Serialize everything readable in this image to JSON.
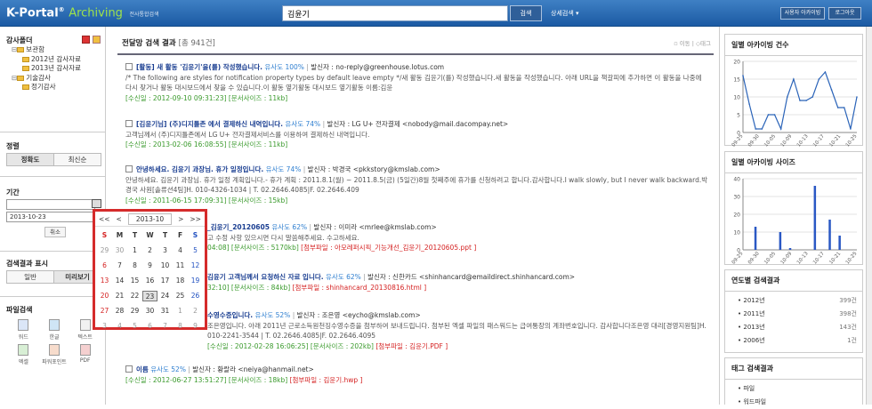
{
  "header": {
    "brand": "K-Portal",
    "brand_reg": "®",
    "app": "Archiving",
    "app_sub": "전사통합검색",
    "search_value": "김윤기",
    "search_button": "검색",
    "advanced": "상세검색",
    "my_button": "사용자 아카이빙",
    "logout_button": "로그아웃"
  },
  "left": {
    "folder_title": "감사폴더",
    "tree": [
      {
        "label": "보관함",
        "level": 0
      },
      {
        "label": "2012년 감사자료",
        "level": 1
      },
      {
        "label": "2013년 감사자료",
        "level": 1
      },
      {
        "label": "기술감사",
        "level": 0
      },
      {
        "label": "정기감사",
        "level": 1
      }
    ],
    "sort_title": "정렬",
    "sort_options": [
      "정확도",
      "최신순"
    ],
    "period_title": "기간",
    "date_from": "",
    "date_to": "2013-10-23",
    "cancel": "취소",
    "display_title": "검색결과 표시",
    "display_options": [
      "일반",
      "미리보기"
    ],
    "file_title": "파일검색",
    "file_types": [
      "워드",
      "한글",
      "텍스트",
      "엑셀",
      "파워포인트",
      "PDF"
    ]
  },
  "main": {
    "title": "전달망 검색 결과",
    "count": "[총 941건]",
    "tools": [
      "이동",
      "태그"
    ],
    "results": [
      {
        "title_pre": "[활동] 새 활동 '",
        "title_hl": "김윤기",
        "title_post": "'을(를) 작성했습니다.",
        "similarity": "유사도 100%",
        "sender": "발신자 : no-reply@greenhouse.lotus.com",
        "desc": "/* The following are styles for notification property types by default leave empty */새 활동 김윤기(를) 작성했습니다.새 활동을 작성했습니다. 아래 URL을 책갈피에 추가하면 이 활동을 나중에 다시 찾거나 활동 대시보드에서 찾을 수 있습니다.이 활동 옆기활동 대시보드 옆기활동 이름:김윤",
        "meta": "[수신일 : 2012-09-10 09:31:23] [문서사이즈 : 11kb]",
        "attach": ""
      },
      {
        "title_pre": "[김윤기님] (주)디지틀존 에서 결제하신 내역입니다.",
        "title_hl": "",
        "title_post": "",
        "similarity": "유사도 74%",
        "sender": "발신자 : LG U+ 전자결제 <nobody@mail.dacompay.net>",
        "desc": "고객님께서 (주)디지틀존에서 LG U+ 전자결제서비스를 이용하여 결제하신 내역입니다.",
        "meta": "[수신일 : 2013-02-06 16:08:55] [문서사이즈 : 11kb]",
        "attach": ""
      },
      {
        "title_pre": "안녕하세요. 김윤기 과장님. 휴가 일정입니다.",
        "title_hl": "",
        "title_post": "",
        "similarity": "유사도 74%",
        "sender": "발신자 : 박경국 <pkkstory@kmslab.com>",
        "desc": "안녕하세요. 김윤기 과장님. 휴가 일정 계획입니다.- 휴가 계획 : 2011.8.1(월) ~ 2011.8.5(금) (5일간)8월 첫째주에 휴가를 신청하려고 합니다.감사합니다.I walk slowly, but I never walk backward.박경국 사원[솔류션4팀]H. 010-4326-1034 | T. 02.2646.4085|F. 02.2646.409",
        "meta": "[수신일 : 2011-06-15 17:09:31] [문서사이즈 : 15kb]",
        "attach": ""
      },
      {
        "title_pre": "_김윤기_20120605",
        "title_hl": "",
        "title_post": "",
        "similarity": "유사도 62%",
        "sender": "발신자 : 이미라 <mrlee@kmslab.com>",
        "desc": "고 수정 사항 있으시면 다시 말씀해주세요. 수고하세요.",
        "meta": "04:08] [문서사이즈 : 5170kb]",
        "attach": "[첨부파일 : 아모레퍼시픽_기능개선_김윤기_20120605.ppt ]"
      },
      {
        "title_pre": "김윤기 고객님께서 요청하신 자료 입니다.",
        "title_hl": "",
        "title_post": "",
        "similarity": "유사도 62%",
        "sender": "발신자 : 신한카드 <shinhancard@emaildirect.shinhancard.com>",
        "desc": "",
        "meta": "32:10] [문서사이즈 : 84kb]",
        "attach": "[첨부파일 : shinhancard_20130816.html ]"
      },
      {
        "title_pre": "수영수증입니다.",
        "title_hl": "",
        "title_post": "",
        "similarity": "유사도 52%",
        "sender": "발신자 : 조은영 <eycho@kmslab.com>",
        "desc": "조은영입니다. 아래 2011년 근로소득원천징수영수증을 첨부하여 보내드립니다. 첨부된 엑셀 파일의 패스워드는 급여통장의 계좌번호입니다. 감사합니다조은영 대리[경영지원팀]H. 010-2241-3544 | T. 02.2646.4085|F. 02.2646.4095",
        "meta": "[수신일 : 2012-02-28 16:06:25] [문서사이즈 : 202kb]",
        "attach": "[첨부파일 : 김윤기.PDF ]"
      },
      {
        "title_pre": "이름",
        "title_hl": "",
        "title_post": "",
        "similarity": "유사도 52%",
        "sender": "발신자 : 황랄라 <neiya@hanmail.net>",
        "desc": "",
        "meta": "[수신일 : 2012-06-27 13:51:27] [문서사이즈 : 18kb]",
        "attach": "[첨부파일 : 김윤기.hwp ]"
      }
    ]
  },
  "calendar": {
    "prev_year": "<<",
    "prev_month": "<",
    "month": "2013-10",
    "next_month": ">",
    "next_year": ">>",
    "weekdays": [
      "S",
      "M",
      "T",
      "W",
      "T",
      "F",
      "S"
    ],
    "days": [
      "29",
      "30",
      "1",
      "2",
      "3",
      "4",
      "5",
      "6",
      "7",
      "8",
      "9",
      "10",
      "11",
      "12",
      "13",
      "14",
      "15",
      "16",
      "17",
      "18",
      "19",
      "20",
      "21",
      "22",
      "23",
      "24",
      "25",
      "26",
      "27",
      "28",
      "29",
      "30",
      "31",
      "1",
      "2",
      "3",
      "4",
      "5",
      "6",
      "7",
      "8",
      "9"
    ],
    "selected": "23"
  },
  "right": {
    "daily_count_title": "일별 아카이빙 건수",
    "daily_size_title": "일별 아카이빙 사이즈",
    "year_title": "연도별 검색결과",
    "year_stats": [
      {
        "label": "2012년",
        "value": "399건"
      },
      {
        "label": "2011년",
        "value": "398건"
      },
      {
        "label": "2013년",
        "value": "143건"
      },
      {
        "label": "2006년",
        "value": "1건"
      }
    ],
    "tag_title": "태그 검색결과",
    "tags": [
      "파일",
      "워드파일"
    ]
  },
  "chart_data": [
    {
      "type": "line",
      "x": [
        "09-25",
        "09-30",
        "10-05",
        "10-09",
        "10-13",
        "10-17",
        "10-21",
        "10-25"
      ],
      "values": [
        16,
        8,
        1,
        1,
        5,
        5,
        1,
        10,
        15,
        9,
        9,
        10,
        15,
        17,
        12,
        7,
        7,
        1,
        10
      ],
      "ylim": [
        0,
        20
      ],
      "yticks": [
        0,
        5,
        10,
        15,
        20
      ]
    },
    {
      "type": "bar",
      "x": [
        "09-25",
        "09-30",
        "10-05",
        "10-09",
        "10-13",
        "10-17",
        "10-21",
        "10-25"
      ],
      "values": [
        0,
        0,
        13,
        0,
        0,
        0,
        0,
        10,
        0,
        1,
        0,
        0,
        0,
        0,
        36,
        0,
        0,
        17,
        0,
        8,
        0,
        0,
        0
      ],
      "ylim": [
        0,
        40
      ],
      "yticks": [
        0,
        10,
        20,
        30,
        40
      ]
    }
  ]
}
